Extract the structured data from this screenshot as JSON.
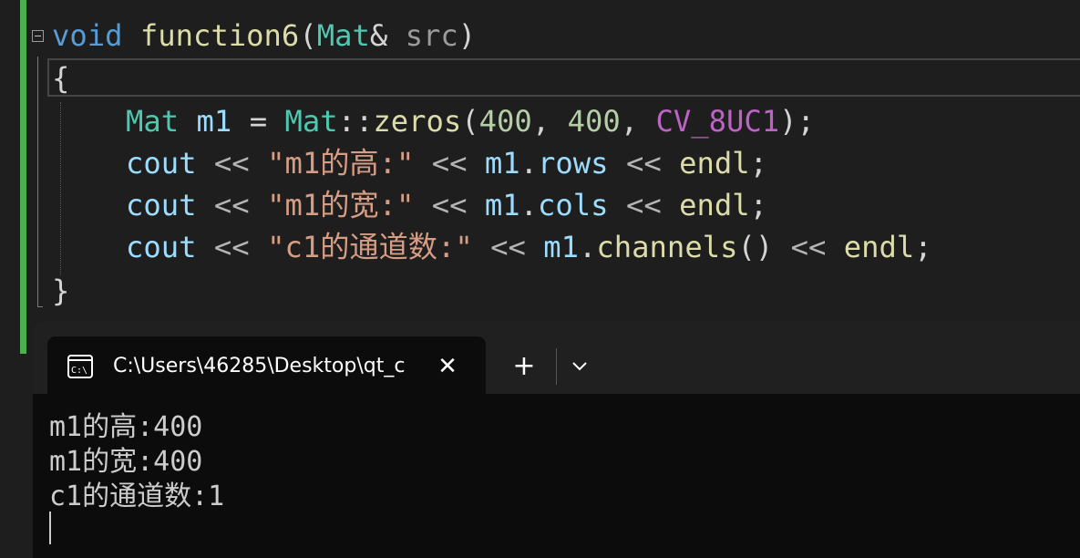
{
  "editor": {
    "sig": {
      "kw": "void",
      "fn": "function6",
      "open": "(",
      "type": "Mat",
      "amp": "& ",
      "param": "src",
      "close": ")"
    },
    "brace_open": "{",
    "line1": {
      "type1": "Mat",
      "var": "m1",
      "eq": "=",
      "type2": "Mat",
      "scope": "::",
      "fn": "zeros",
      "open": "(",
      "n1": "400",
      "c1": ",",
      "n2": "400",
      "c2": ",",
      "macro": "CV_8UC1",
      "close": ");"
    },
    "line2": {
      "cout": "cout",
      "op1": "<<",
      "str": "\"m1的高:\"",
      "op2": "<<",
      "var": "m1",
      "dot": ".",
      "member": "rows",
      "op3": "<<",
      "endl": "endl",
      "semi": ";"
    },
    "line3": {
      "cout": "cout",
      "op1": "<<",
      "str": "\"m1的宽:\"",
      "op2": "<<",
      "var": "m1",
      "dot": ".",
      "member": "cols",
      "op3": "<<",
      "endl": "endl",
      "semi": ";"
    },
    "line4": {
      "cout": "cout",
      "op1": "<<",
      "str": "\"c1的通道数:\"",
      "op2": "<<",
      "var": "m1",
      "dot": ".",
      "member": "channels",
      "paren": "()",
      "op3": "<<",
      "endl": "endl",
      "semi": ";"
    },
    "brace_close": "}"
  },
  "terminal": {
    "tab_title": "C:\\Users\\46285\\Desktop\\qt_c",
    "close_glyph": "✕",
    "new_tab_glyph": "+",
    "icon_text": "C:\\",
    "output": [
      "m1的高:400",
      "m1的宽:400",
      "c1的通道数:1"
    ]
  },
  "colors": {
    "editor_bg": "#1e1e1e",
    "change_bar": "#4caf50",
    "keyword": "#569cd6",
    "function": "#dcdcaa",
    "type": "#4ec9b0",
    "string": "#d69d85",
    "number": "#b5cea8",
    "macro": "#bd63c5",
    "terminal_bg": "#0c0c0c",
    "tabbar_bg": "#202020"
  },
  "icons": [
    "fold-minus-icon",
    "terminal-icon",
    "close-icon",
    "plus-icon",
    "chevron-down-icon"
  ]
}
